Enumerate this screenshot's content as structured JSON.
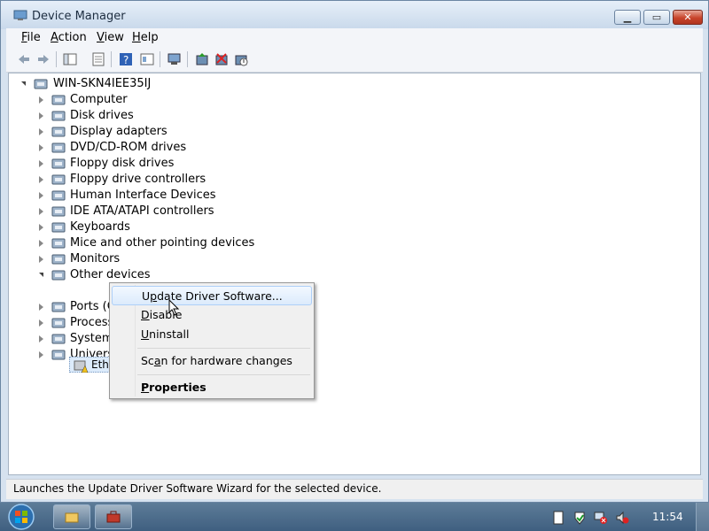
{
  "window": {
    "title": "Device Manager"
  },
  "menu": [
    {
      "label": "File",
      "accel": "F",
      "rest": "ile"
    },
    {
      "label": "Action",
      "accel": "A",
      "rest": "ction"
    },
    {
      "label": "View",
      "accel": "V",
      "rest": "iew"
    },
    {
      "label": "Help",
      "accel": "H",
      "rest": "elp"
    }
  ],
  "toolbar_icons": [
    "back-icon",
    "forward-icon",
    "show-hide-tree-icon",
    "properties-icon",
    "help-icon",
    "toggle-view-icon",
    "scan-hardware-icon",
    "update-driver-icon",
    "uninstall-icon",
    "disable-icon"
  ],
  "tree": {
    "root": "WIN-SKN4IEE35IJ",
    "categories": [
      {
        "label": "Computer",
        "icon": "computer-icon"
      },
      {
        "label": "Disk drives",
        "icon": "disk-drive-icon"
      },
      {
        "label": "Display adapters",
        "icon": "display-adapter-icon"
      },
      {
        "label": "DVD/CD-ROM drives",
        "icon": "dvd-drive-icon"
      },
      {
        "label": "Floppy disk drives",
        "icon": "floppy-disk-icon"
      },
      {
        "label": "Floppy drive controllers",
        "icon": "floppy-controller-icon"
      },
      {
        "label": "Human Interface Devices",
        "icon": "hid-icon"
      },
      {
        "label": "IDE ATA/ATAPI controllers",
        "icon": "ide-controller-icon"
      },
      {
        "label": "Keyboards",
        "icon": "keyboard-icon"
      },
      {
        "label": "Mice and other pointing devices",
        "icon": "mouse-icon"
      },
      {
        "label": "Monitors",
        "icon": "monitor-icon"
      },
      {
        "label": "Other devices",
        "icon": "other-devices-icon"
      },
      {
        "label": "Ports (CO",
        "icon": "port-icon"
      },
      {
        "label": "Processo",
        "icon": "processor-icon"
      },
      {
        "label": "System c",
        "icon": "system-device-icon"
      },
      {
        "label": "Universa",
        "icon": "usb-icon"
      }
    ],
    "child": {
      "label": "Ether",
      "icon": "warning-device-icon"
    }
  },
  "context_menu": [
    {
      "label": "Update Driver Software...",
      "accel": "p",
      "pre": "U",
      "post": "date Driver Software...",
      "hover": true
    },
    {
      "label": "Disable",
      "accel": "D",
      "pre": "",
      "post": "isable"
    },
    {
      "label": "Uninstall",
      "accel": "U",
      "pre": "",
      "post": "ninstall"
    },
    {
      "label": "Scan for hardware changes",
      "accel": "a",
      "pre": "Sc",
      "post": "n for hardware changes"
    },
    {
      "label": "Properties",
      "accel": "P",
      "pre": "",
      "post": "roperties",
      "bold": true
    }
  ],
  "status": "Launches the Update Driver Software Wizard for the selected device.",
  "taskbar": {
    "clock": "11:54"
  },
  "colors": {
    "accent": "#3f5f80",
    "hover": "#dcebfc",
    "window": "#d6e2ef"
  }
}
